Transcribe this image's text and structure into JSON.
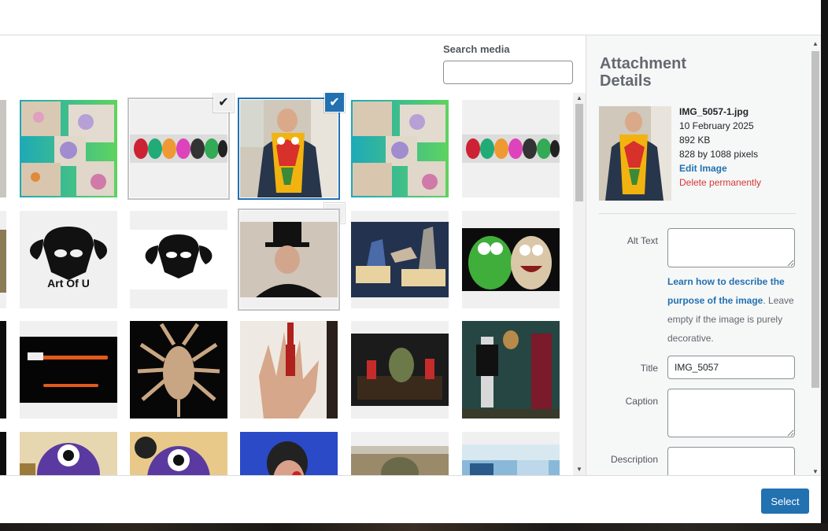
{
  "search": {
    "label": "Search media",
    "value": "",
    "placeholder": ""
  },
  "sidebar": {
    "title": "Attachment Details",
    "filename": "IMG_5057-1.jpg",
    "date": "10 February 2025",
    "filesize": "892 KB",
    "dimensions": "828 by 1088 pixels",
    "edit_label": "Edit Image",
    "delete_label": "Delete permanently",
    "fields": {
      "alt_label": "Alt Text",
      "alt_value": "",
      "title_label": "Title",
      "title_value": "IMG_5057",
      "caption_label": "Caption",
      "caption_value": "",
      "description_label": "Description",
      "description_value": ""
    },
    "help_link": "Learn how to describe the purpose of the image",
    "help_text": ". Leave empty if the image is purely decorative."
  },
  "logo_text": "Art Of U",
  "footer": {
    "select_label": "Select"
  },
  "icons": {
    "check": "checkmark-icon",
    "scroll_up": "arrow-up-icon",
    "scroll_down": "arrow-down-icon"
  },
  "colors": {
    "accent": "#2271b1",
    "danger": "#d63638"
  }
}
